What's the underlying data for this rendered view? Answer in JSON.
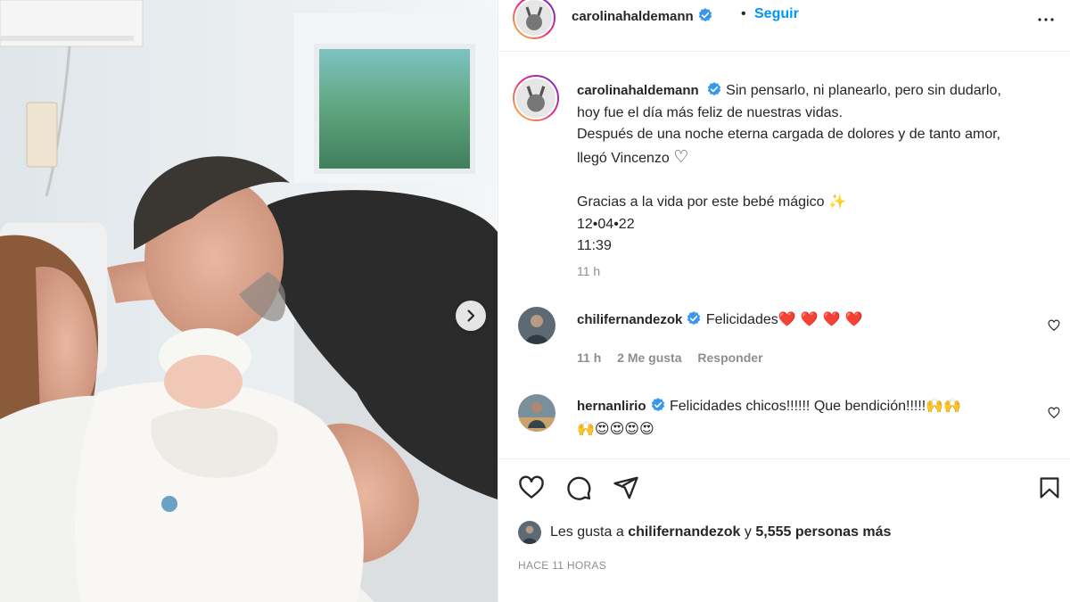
{
  "post": {
    "author": "carolinahaldemann",
    "follow_label": "Seguir",
    "follow_separator": "•",
    "caption_lines": [
      "Sin pensarlo, ni planearlo, pero sin dudarlo,",
      "hoy fue el día más feliz de nuestras vidas.",
      "Después de una noche eterna cargada de dolores y de tanto amor,",
      "llegó Vincenzo",
      "",
      "Gracias a la vida por este bebé mágico",
      "12•04•22",
      "11:39"
    ],
    "caption_emoji_heart": "♡",
    "caption_emoji_sparkle": "✨",
    "caption_time": "11 h",
    "timestamp": "HACE 11 HORAS"
  },
  "comments": [
    {
      "user": "chilifernandezok",
      "text": "Felicidades",
      "hearts": "❤️ ❤️ ❤️ ❤️",
      "time": "11 h",
      "likes": "2 Me gusta",
      "reply_label": "Responder"
    },
    {
      "user": "hernanlirio",
      "text": "Felicidades chicos!!!!!! Que bendición!!!!!",
      "emoji_line1": "🙌🙌",
      "emoji_line2": "🙌😍😍😍😍"
    }
  ],
  "likes": {
    "prefix": "Les gusta a",
    "user": "chilifernandezok",
    "joiner": "y",
    "others": "5,555 personas más"
  },
  "icons": {
    "verified": "verified-badge-icon",
    "more": "more-options-icon",
    "like": "heart-icon",
    "comment": "comment-icon",
    "share": "share-icon",
    "save": "bookmark-icon",
    "next": "chevron-right-icon"
  },
  "colors": {
    "link_blue": "#0095f6",
    "text": "#262626",
    "muted": "#8e8e8e",
    "verified": "#3897f0",
    "border": "#efefef"
  }
}
